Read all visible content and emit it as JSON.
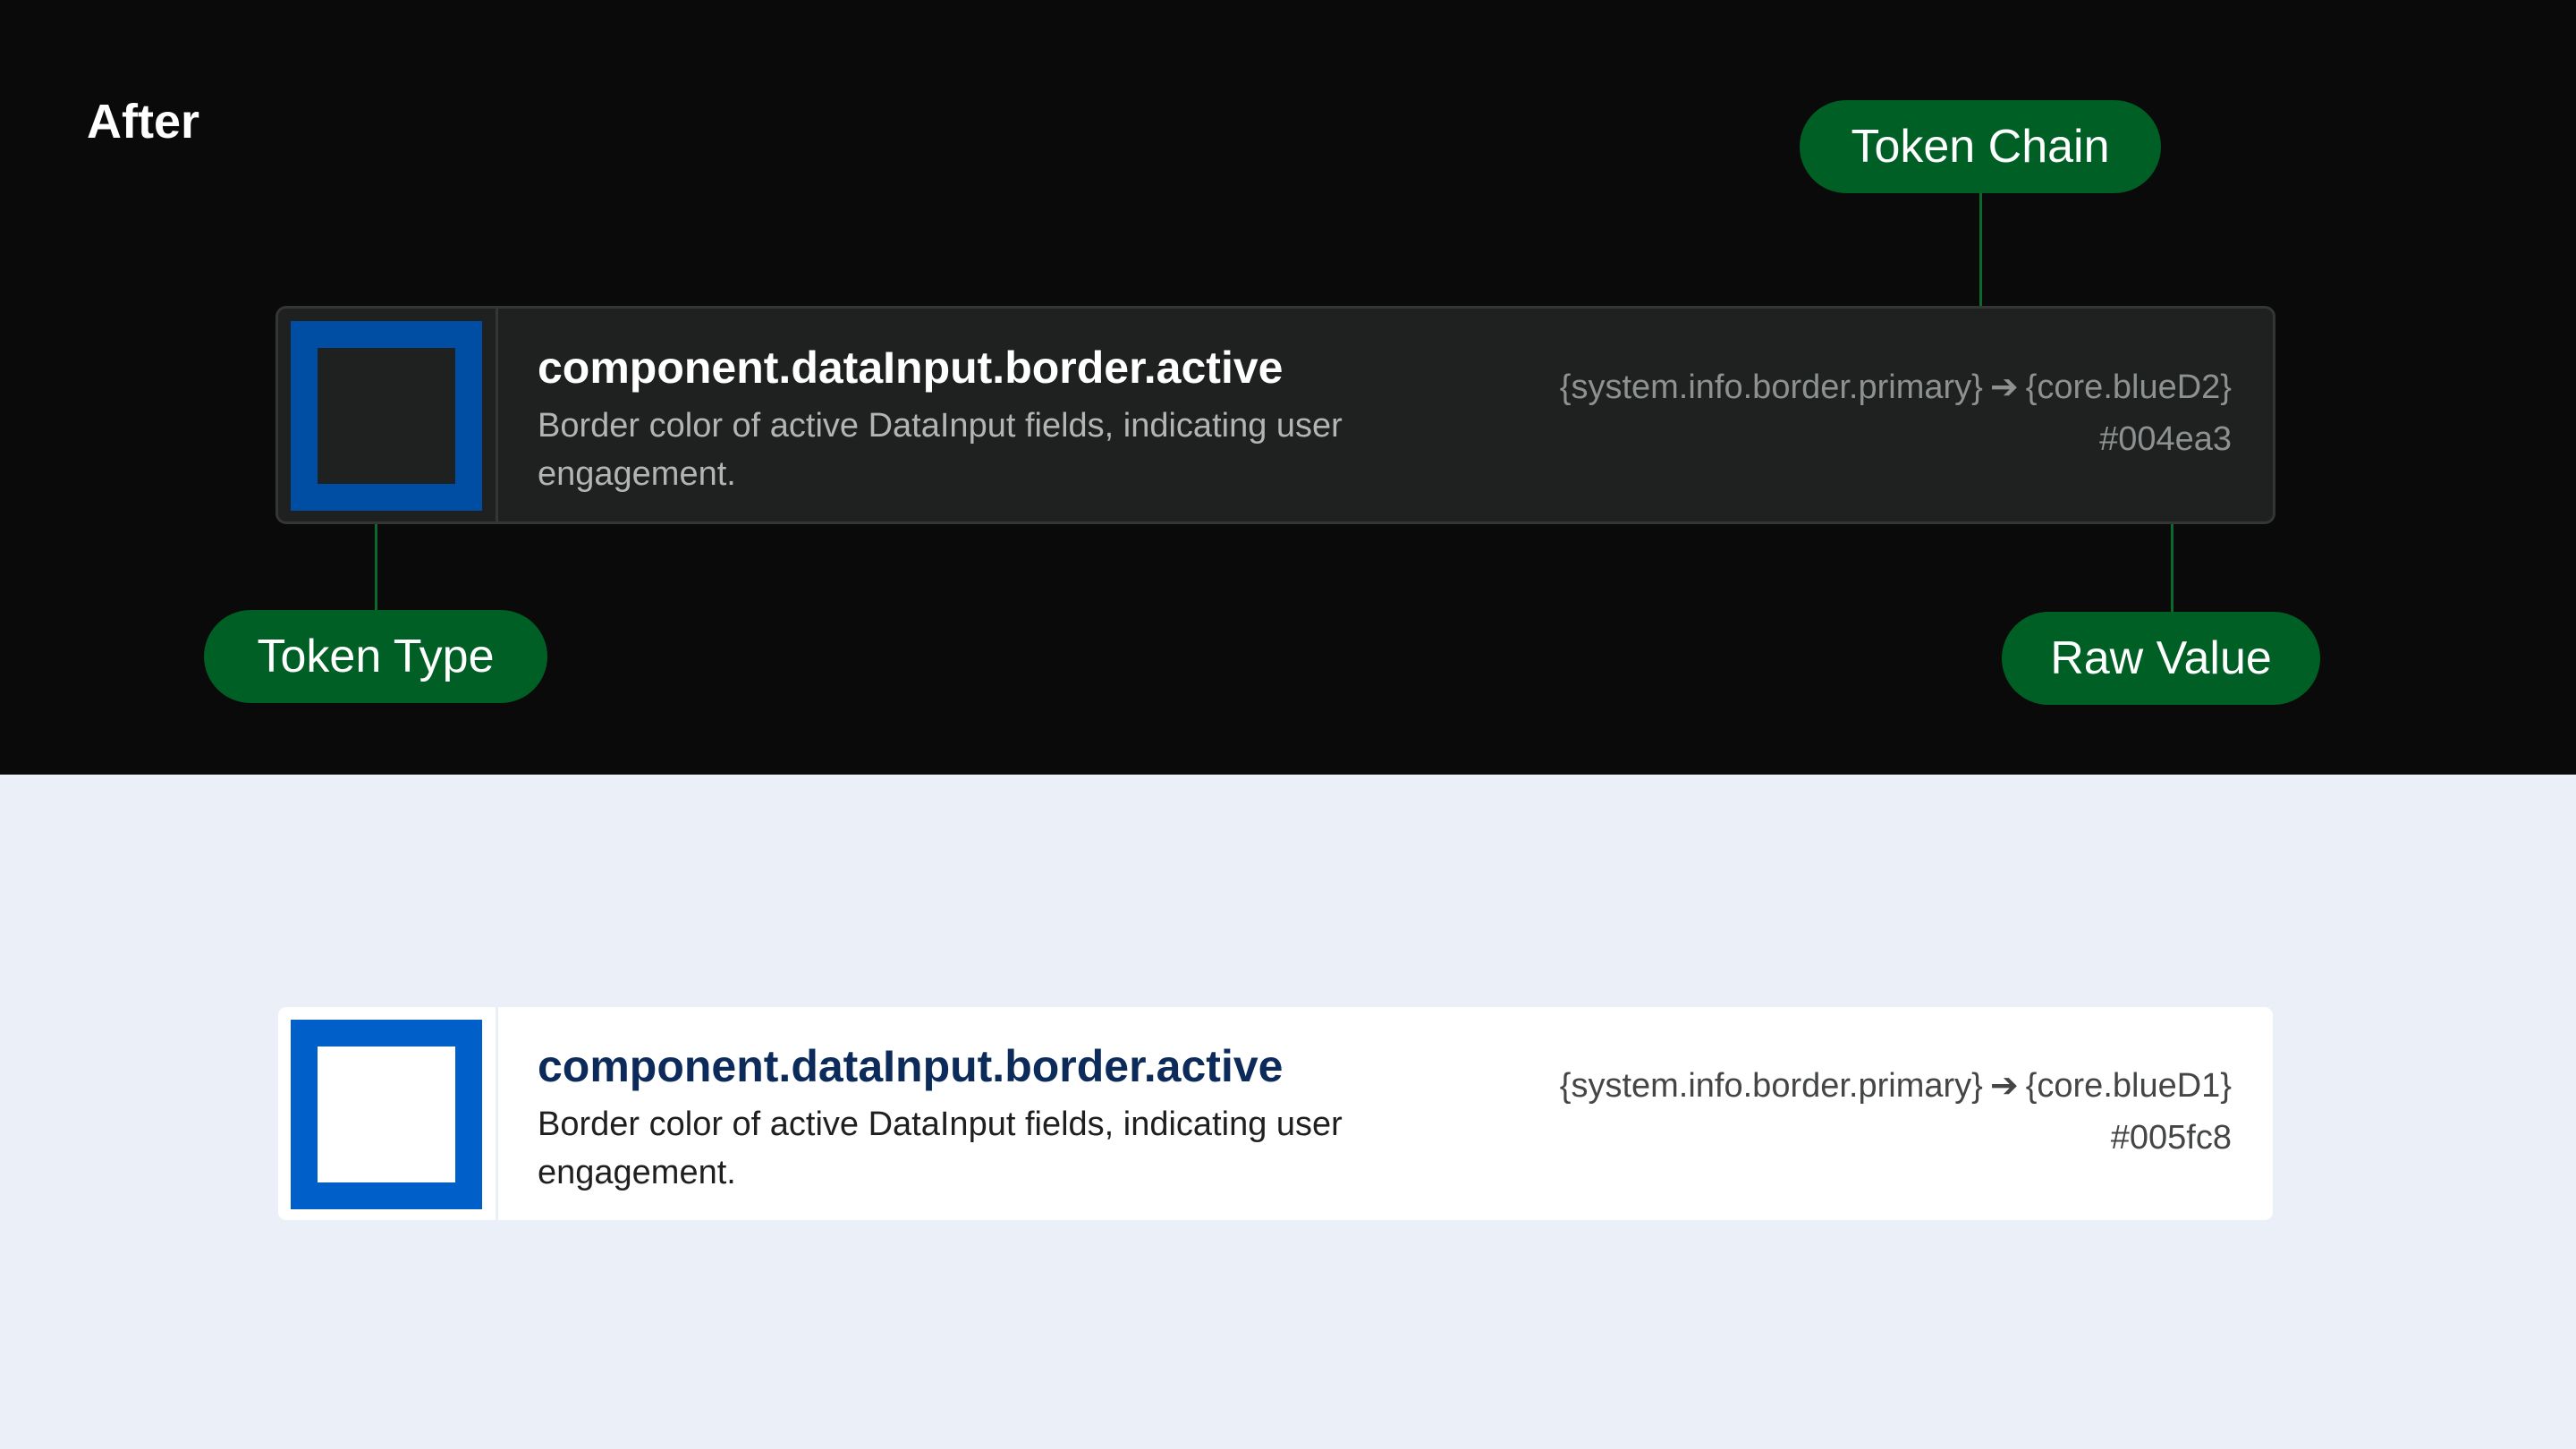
{
  "sections": {
    "after": {
      "heading": "After",
      "token": {
        "name": "component.dataInput.border.active",
        "description": "Border color of active DataInput fields, indicating user engagement.",
        "chain_from": "{system.info.border.primary}",
        "chain_arrow": "➔",
        "chain_to": "{core.blueD2}",
        "raw_value": "#004ea3",
        "swatch_color": "#004ea3"
      },
      "callouts": {
        "token_chain": "Token Chain",
        "token_type": "Token Type",
        "raw_value": "Raw Value"
      }
    },
    "light": {
      "token": {
        "name": "component.dataInput.border.active",
        "description": "Border color of active DataInput fields, indicating user engagement.",
        "chain_from": "{system.info.border.primary}",
        "chain_arrow": "➔",
        "chain_to": "{core.blueD1}",
        "raw_value": "#005fc8",
        "swatch_color": "#005fc8"
      }
    }
  },
  "colors": {
    "dark_background": "#0a0a0a",
    "light_background": "#ebeff7",
    "callout_green": "#005f24",
    "connector_green": "#0b6a2b"
  }
}
